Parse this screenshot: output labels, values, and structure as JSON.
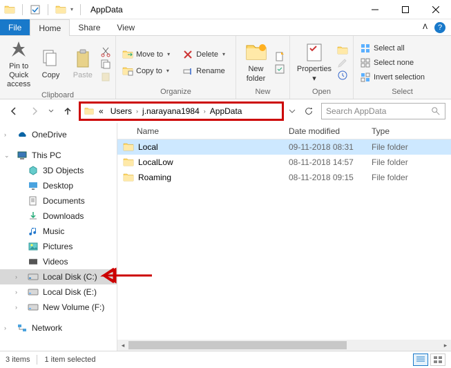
{
  "title": "AppData",
  "tabs": {
    "file": "File",
    "home": "Home",
    "share": "Share",
    "view": "View"
  },
  "ribbon": {
    "clipboard": {
      "pin": "Pin to Quick\naccess",
      "copy": "Copy",
      "paste": "Paste",
      "label": "Clipboard"
    },
    "organize": {
      "move": "Move to",
      "copyto": "Copy to",
      "delete": "Delete",
      "rename": "Rename",
      "label": "Organize"
    },
    "new": {
      "folder": "New\nfolder",
      "label": "New"
    },
    "open": {
      "properties": "Properties",
      "label": "Open"
    },
    "select": {
      "all": "Select all",
      "none": "Select none",
      "invert": "Invert selection",
      "label": "Select"
    }
  },
  "breadcrumb": {
    "prefix": "«",
    "p1": "Users",
    "p2": "j.narayana1984",
    "p3": "AppData"
  },
  "search": {
    "placeholder": "Search AppData"
  },
  "columns": {
    "name": "Name",
    "date": "Date modified",
    "type": "Type"
  },
  "tree": {
    "onedrive": "OneDrive",
    "thispc": "This PC",
    "objects3d": "3D Objects",
    "desktop": "Desktop",
    "documents": "Documents",
    "downloads": "Downloads",
    "music": "Music",
    "pictures": "Pictures",
    "videos": "Videos",
    "diskc": "Local Disk (C:)",
    "diske": "Local Disk (E:)",
    "diskf": "New Volume (F:)",
    "network": "Network"
  },
  "files": [
    {
      "name": "Local",
      "date": "09-11-2018 08:31",
      "type": "File folder",
      "sel": true
    },
    {
      "name": "LocalLow",
      "date": "08-11-2018 14:57",
      "type": "File folder",
      "sel": false
    },
    {
      "name": "Roaming",
      "date": "08-11-2018 09:15",
      "type": "File folder",
      "sel": false
    }
  ],
  "status": {
    "items": "3 items",
    "selected": "1 item selected"
  }
}
